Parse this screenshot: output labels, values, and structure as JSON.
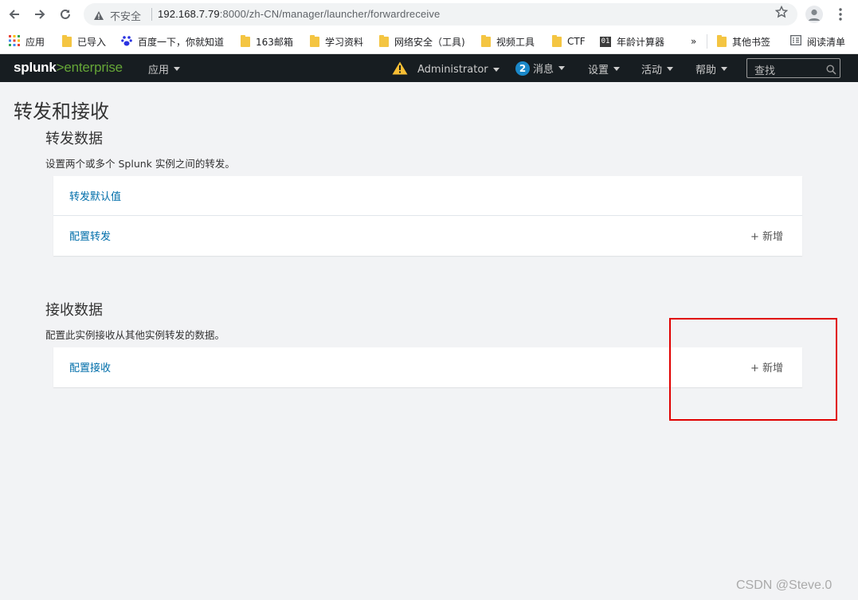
{
  "browser": {
    "security_label": "不安全",
    "url_host": "192.168.7.79",
    "url_rest": ":8000/zh-CN/manager/launcher/forwardreceive"
  },
  "bookmarks": [
    {
      "label": "应用",
      "icon": "apps-grid-icon"
    },
    {
      "label": "已导入",
      "icon": "folder-icon"
    },
    {
      "label": "百度一下，你就知道",
      "icon": "baidu-paw-icon"
    },
    {
      "label": "163邮箱",
      "icon": "folder-icon"
    },
    {
      "label": "学习资料",
      "icon": "folder-icon"
    },
    {
      "label": "网络安全（工具)",
      "icon": "folder-icon"
    },
    {
      "label": "视频工具",
      "icon": "folder-icon"
    },
    {
      "label": "CTF",
      "icon": "folder-icon"
    },
    {
      "label": "年龄计算器",
      "icon": "01-icon",
      "icon_text": "01"
    },
    {
      "label": "其他书签",
      "icon": "folder-icon"
    },
    {
      "label": "阅读清单",
      "icon": "reading-list-icon"
    }
  ],
  "bookmarks_overflow": "»",
  "splunk": {
    "logo_splunk": "splunk",
    "logo_gt": ">",
    "logo_enterprise": "enterprise",
    "menu": {
      "apps": "应用",
      "user": "Administrator",
      "messages_count": "2",
      "messages": "消息",
      "settings": "设置",
      "activity": "活动",
      "help": "帮助"
    },
    "search_placeholder": "查找",
    "brand_color": "#65a637"
  },
  "page": {
    "title": "转发和接收",
    "forward": {
      "title": "转发数据",
      "description": "设置两个或多个 Splunk 实例之间的转发。",
      "rows": [
        {
          "label": "转发默认值",
          "add": ""
        },
        {
          "label": "配置转发",
          "add": "+ 新增"
        }
      ]
    },
    "receive": {
      "title": "接收数据",
      "description": "配置此实例接收从其他实例转发的数据。",
      "rows": [
        {
          "label": "配置接收",
          "add": "+ 新增"
        }
      ]
    }
  },
  "watermark": "CSDN @Steve.0"
}
